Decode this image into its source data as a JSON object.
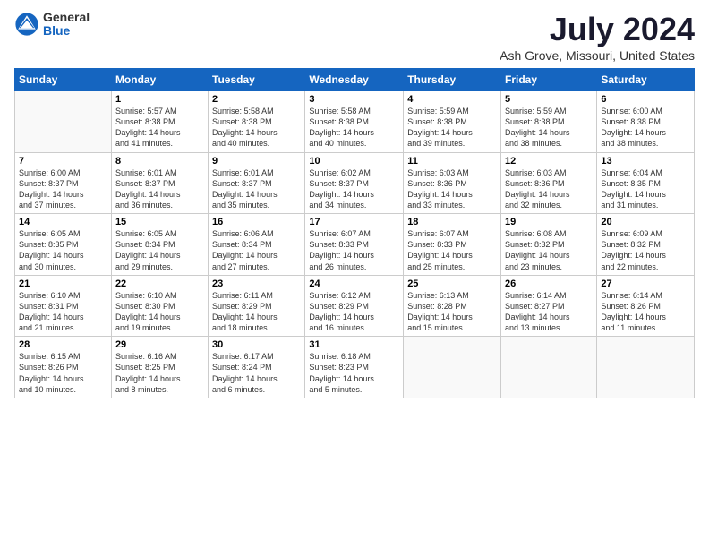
{
  "header": {
    "logo_general": "General",
    "logo_blue": "Blue",
    "month_title": "July 2024",
    "location": "Ash Grove, Missouri, United States"
  },
  "days_of_week": [
    "Sunday",
    "Monday",
    "Tuesday",
    "Wednesday",
    "Thursday",
    "Friday",
    "Saturday"
  ],
  "weeks": [
    [
      {
        "day": "",
        "empty": true
      },
      {
        "day": "1",
        "sunrise": "Sunrise: 5:57 AM",
        "sunset": "Sunset: 8:38 PM",
        "daylight": "Daylight: 14 hours and 41 minutes."
      },
      {
        "day": "2",
        "sunrise": "Sunrise: 5:58 AM",
        "sunset": "Sunset: 8:38 PM",
        "daylight": "Daylight: 14 hours and 40 minutes."
      },
      {
        "day": "3",
        "sunrise": "Sunrise: 5:58 AM",
        "sunset": "Sunset: 8:38 PM",
        "daylight": "Daylight: 14 hours and 40 minutes."
      },
      {
        "day": "4",
        "sunrise": "Sunrise: 5:59 AM",
        "sunset": "Sunset: 8:38 PM",
        "daylight": "Daylight: 14 hours and 39 minutes."
      },
      {
        "day": "5",
        "sunrise": "Sunrise: 5:59 AM",
        "sunset": "Sunset: 8:38 PM",
        "daylight": "Daylight: 14 hours and 38 minutes."
      },
      {
        "day": "6",
        "sunrise": "Sunrise: 6:00 AM",
        "sunset": "Sunset: 8:38 PM",
        "daylight": "Daylight: 14 hours and 38 minutes."
      }
    ],
    [
      {
        "day": "7",
        "sunrise": "Sunrise: 6:00 AM",
        "sunset": "Sunset: 8:37 PM",
        "daylight": "Daylight: 14 hours and 37 minutes."
      },
      {
        "day": "8",
        "sunrise": "Sunrise: 6:01 AM",
        "sunset": "Sunset: 8:37 PM",
        "daylight": "Daylight: 14 hours and 36 minutes."
      },
      {
        "day": "9",
        "sunrise": "Sunrise: 6:01 AM",
        "sunset": "Sunset: 8:37 PM",
        "daylight": "Daylight: 14 hours and 35 minutes."
      },
      {
        "day": "10",
        "sunrise": "Sunrise: 6:02 AM",
        "sunset": "Sunset: 8:37 PM",
        "daylight": "Daylight: 14 hours and 34 minutes."
      },
      {
        "day": "11",
        "sunrise": "Sunrise: 6:03 AM",
        "sunset": "Sunset: 8:36 PM",
        "daylight": "Daylight: 14 hours and 33 minutes."
      },
      {
        "day": "12",
        "sunrise": "Sunrise: 6:03 AM",
        "sunset": "Sunset: 8:36 PM",
        "daylight": "Daylight: 14 hours and 32 minutes."
      },
      {
        "day": "13",
        "sunrise": "Sunrise: 6:04 AM",
        "sunset": "Sunset: 8:35 PM",
        "daylight": "Daylight: 14 hours and 31 minutes."
      }
    ],
    [
      {
        "day": "14",
        "sunrise": "Sunrise: 6:05 AM",
        "sunset": "Sunset: 8:35 PM",
        "daylight": "Daylight: 14 hours and 30 minutes."
      },
      {
        "day": "15",
        "sunrise": "Sunrise: 6:05 AM",
        "sunset": "Sunset: 8:34 PM",
        "daylight": "Daylight: 14 hours and 29 minutes."
      },
      {
        "day": "16",
        "sunrise": "Sunrise: 6:06 AM",
        "sunset": "Sunset: 8:34 PM",
        "daylight": "Daylight: 14 hours and 27 minutes."
      },
      {
        "day": "17",
        "sunrise": "Sunrise: 6:07 AM",
        "sunset": "Sunset: 8:33 PM",
        "daylight": "Daylight: 14 hours and 26 minutes."
      },
      {
        "day": "18",
        "sunrise": "Sunrise: 6:07 AM",
        "sunset": "Sunset: 8:33 PM",
        "daylight": "Daylight: 14 hours and 25 minutes."
      },
      {
        "day": "19",
        "sunrise": "Sunrise: 6:08 AM",
        "sunset": "Sunset: 8:32 PM",
        "daylight": "Daylight: 14 hours and 23 minutes."
      },
      {
        "day": "20",
        "sunrise": "Sunrise: 6:09 AM",
        "sunset": "Sunset: 8:32 PM",
        "daylight": "Daylight: 14 hours and 22 minutes."
      }
    ],
    [
      {
        "day": "21",
        "sunrise": "Sunrise: 6:10 AM",
        "sunset": "Sunset: 8:31 PM",
        "daylight": "Daylight: 14 hours and 21 minutes."
      },
      {
        "day": "22",
        "sunrise": "Sunrise: 6:10 AM",
        "sunset": "Sunset: 8:30 PM",
        "daylight": "Daylight: 14 hours and 19 minutes."
      },
      {
        "day": "23",
        "sunrise": "Sunrise: 6:11 AM",
        "sunset": "Sunset: 8:29 PM",
        "daylight": "Daylight: 14 hours and 18 minutes."
      },
      {
        "day": "24",
        "sunrise": "Sunrise: 6:12 AM",
        "sunset": "Sunset: 8:29 PM",
        "daylight": "Daylight: 14 hours and 16 minutes."
      },
      {
        "day": "25",
        "sunrise": "Sunrise: 6:13 AM",
        "sunset": "Sunset: 8:28 PM",
        "daylight": "Daylight: 14 hours and 15 minutes."
      },
      {
        "day": "26",
        "sunrise": "Sunrise: 6:14 AM",
        "sunset": "Sunset: 8:27 PM",
        "daylight": "Daylight: 14 hours and 13 minutes."
      },
      {
        "day": "27",
        "sunrise": "Sunrise: 6:14 AM",
        "sunset": "Sunset: 8:26 PM",
        "daylight": "Daylight: 14 hours and 11 minutes."
      }
    ],
    [
      {
        "day": "28",
        "sunrise": "Sunrise: 6:15 AM",
        "sunset": "Sunset: 8:26 PM",
        "daylight": "Daylight: 14 hours and 10 minutes."
      },
      {
        "day": "29",
        "sunrise": "Sunrise: 6:16 AM",
        "sunset": "Sunset: 8:25 PM",
        "daylight": "Daylight: 14 hours and 8 minutes."
      },
      {
        "day": "30",
        "sunrise": "Sunrise: 6:17 AM",
        "sunset": "Sunset: 8:24 PM",
        "daylight": "Daylight: 14 hours and 6 minutes."
      },
      {
        "day": "31",
        "sunrise": "Sunrise: 6:18 AM",
        "sunset": "Sunset: 8:23 PM",
        "daylight": "Daylight: 14 hours and 5 minutes."
      },
      {
        "day": "",
        "empty": true
      },
      {
        "day": "",
        "empty": true
      },
      {
        "day": "",
        "empty": true
      }
    ]
  ]
}
